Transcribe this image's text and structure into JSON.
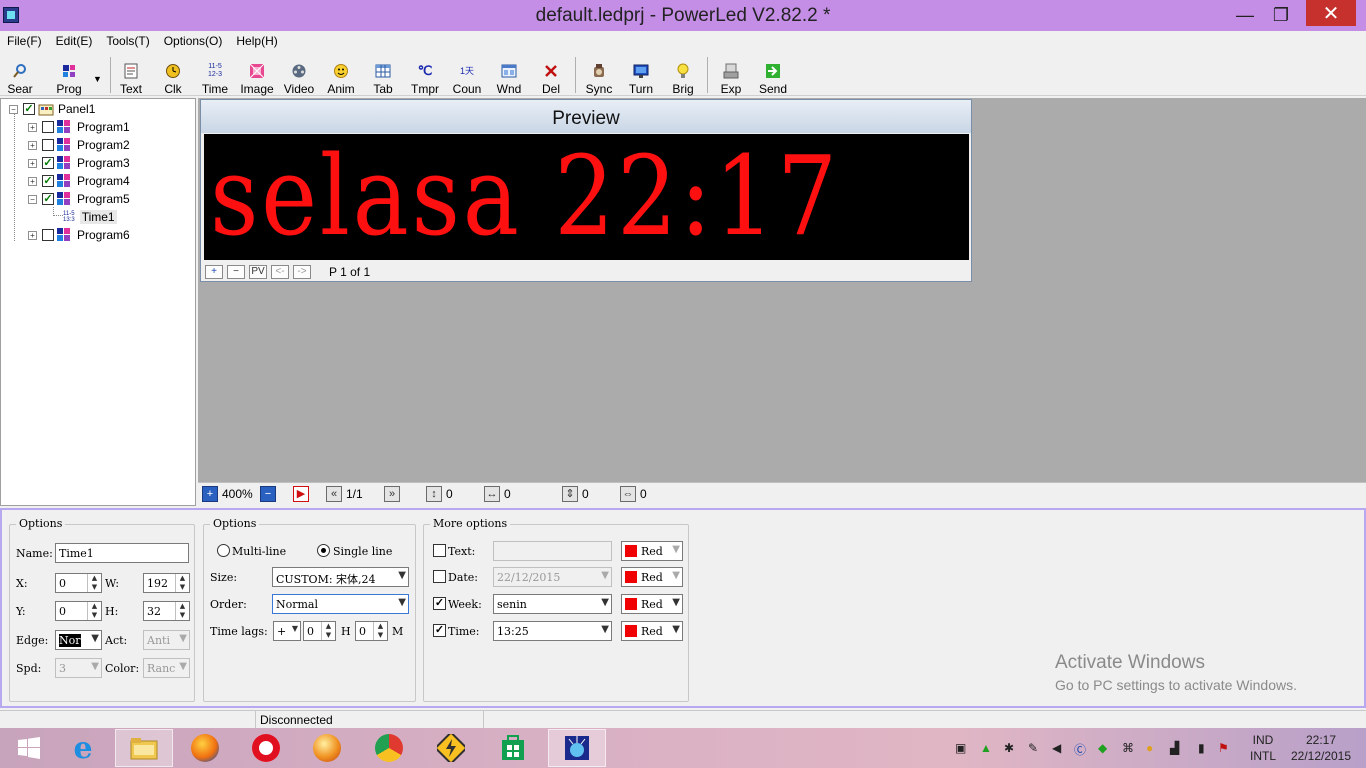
{
  "window": {
    "title": "default.ledprj - PowerLed V2.82.2 *",
    "minimize": "—",
    "maximize": "❐",
    "close": "✕"
  },
  "menu": [
    "File(F)",
    "Edit(E)",
    "Tools(T)",
    "Options(O)",
    "Help(H)"
  ],
  "toolbar": [
    {
      "label": "Sear",
      "icon": "search-icon"
    },
    {
      "label": "Prog",
      "icon": "program-icon"
    },
    {
      "label": "Text",
      "icon": "text-icon"
    },
    {
      "label": "Clk",
      "icon": "clock-icon"
    },
    {
      "label": "Time",
      "icon": "time-icon"
    },
    {
      "label": "Image",
      "icon": "image-icon"
    },
    {
      "label": "Video",
      "icon": "video-icon"
    },
    {
      "label": "Anim",
      "icon": "animation-icon"
    },
    {
      "label": "Tab",
      "icon": "table-icon"
    },
    {
      "label": "Tmpr",
      "icon": "temperature-icon"
    },
    {
      "label": "Coun",
      "icon": "counter-icon"
    },
    {
      "label": "Wnd",
      "icon": "window-icon"
    },
    {
      "label": "Del",
      "icon": "delete-icon"
    },
    {
      "label": "Sync",
      "icon": "sync-icon"
    },
    {
      "label": "Turn",
      "icon": "turn-icon"
    },
    {
      "label": "Brig",
      "icon": "brightness-icon"
    },
    {
      "label": "Exp",
      "icon": "export-icon"
    },
    {
      "label": "Send",
      "icon": "send-icon"
    }
  ],
  "toolbar_glyphs": {
    "time_line1": "11-5",
    "time_line2": "12-3",
    "temperature": "℃",
    "counter": "1天"
  },
  "tree": {
    "panel": "Panel1",
    "programs": [
      {
        "label": "Program1",
        "checked": false
      },
      {
        "label": "Program2",
        "checked": false
      },
      {
        "label": "Program3",
        "checked": true
      },
      {
        "label": "Program4",
        "checked": true
      },
      {
        "label": "Program5",
        "checked": true
      },
      {
        "label": "Program6",
        "checked": false
      }
    ],
    "child": "Time1",
    "child_icon_line1": "11-5",
    "child_icon_line2": "13:3"
  },
  "preview": {
    "title": "Preview",
    "led_text": "selasa 22:17",
    "led_color": "#ff1010",
    "buttons": [
      "+",
      "−",
      "PV",
      "<-",
      "->"
    ],
    "page": "P 1 of 1"
  },
  "navbar": {
    "zoom": "400%",
    "page": "1/1",
    "v1": "0",
    "v2": "0",
    "v3": "0",
    "v4": "0"
  },
  "options1": {
    "title": "Options",
    "name_label": "Name:",
    "name_value": "Time1",
    "x_label": "X:",
    "x_value": "0",
    "w_label": "W:",
    "w_value": "192",
    "y_label": "Y:",
    "y_value": "0",
    "h_label": "H:",
    "h_value": "32",
    "edge_label": "Edge:",
    "edge_value": "Nor",
    "act_label": "Act:",
    "act_value": "Anti",
    "spd_label": "Spd:",
    "spd_value": "3",
    "color_label": "Color:",
    "color_value": "Ranc"
  },
  "options2": {
    "title": "Options",
    "multiline": "Multi-line",
    "singleline": "Single line",
    "size_label": "Size:",
    "size_value": "CUSTOM: 宋体,24",
    "order_label": "Order:",
    "order_value": "Normal",
    "lags_label": "Time lags:",
    "lags_sign": "+",
    "lags_h_value": "0",
    "lags_h_unit": "H",
    "lags_m_value": "0",
    "lags_m_unit": "M"
  },
  "more_options": {
    "title": "More options",
    "rows": [
      {
        "label": "Text:",
        "value": "",
        "checked": false,
        "color": "Red"
      },
      {
        "label": "Date:",
        "value": "22/12/2015",
        "checked": false,
        "color": "Red"
      },
      {
        "label": "Week:",
        "value": "senin",
        "checked": true,
        "color": "Red"
      },
      {
        "label": "Time:",
        "value": "13:25",
        "checked": true,
        "color": "Red"
      }
    ]
  },
  "watermark": {
    "line1": "Activate Windows",
    "line2": "Go to PC settings to activate Windows."
  },
  "status": {
    "connection": "Disconnected"
  },
  "taskbar": {
    "lang1": "IND",
    "lang2": "INTL",
    "time": "22:17",
    "date": "22/12/2015"
  }
}
